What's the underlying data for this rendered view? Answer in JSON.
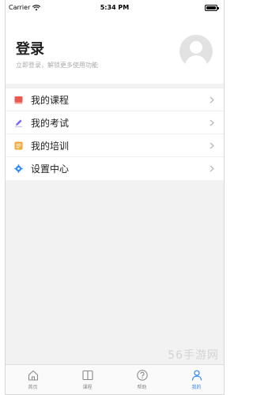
{
  "status_bar": {
    "carrier": "Carrier",
    "time": "5:34 PM"
  },
  "profile": {
    "title": "登录",
    "subtitle": "立即登录，解锁更多使用功能"
  },
  "menu": {
    "items": [
      {
        "label": "我的课程",
        "icon": "book-icon",
        "color": "#e85a4f"
      },
      {
        "label": "我的考试",
        "icon": "pencil-icon",
        "color": "#7b6cf0"
      },
      {
        "label": "我的培训",
        "icon": "training-icon",
        "color": "#f2a93b"
      },
      {
        "label": "设置中心",
        "icon": "gear-icon",
        "color": "#2f86f6"
      }
    ]
  },
  "tabs": [
    {
      "label": "首页",
      "icon": "home-icon",
      "active": false
    },
    {
      "label": "课程",
      "icon": "course-book-icon",
      "active": false
    },
    {
      "label": "帮助",
      "icon": "help-icon",
      "active": false
    },
    {
      "label": "我的",
      "icon": "person-icon",
      "active": true
    }
  ],
  "watermark": "56手游网",
  "colors": {
    "accent": "#2f86f6",
    "background": "#f2f2f2"
  }
}
